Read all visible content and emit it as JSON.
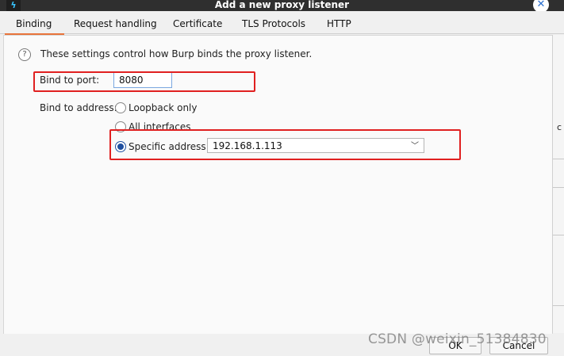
{
  "window": {
    "title": "Add a new proxy listener",
    "app_icon_glyph": "ϟ",
    "close_glyph": "✕"
  },
  "tabs": [
    {
      "label": "Binding",
      "active": true
    },
    {
      "label": "Request handling",
      "active": false
    },
    {
      "label": "Certificate",
      "active": false
    },
    {
      "label": "TLS Protocols",
      "active": false
    },
    {
      "label": "HTTP",
      "active": false
    }
  ],
  "binding": {
    "help_glyph": "?",
    "description": "These settings control how Burp binds the proxy listener.",
    "port_label": "Bind to port:",
    "port_value": "8080",
    "address_label": "Bind to address:",
    "options": [
      {
        "label": "Loopback only",
        "selected": false
      },
      {
        "label": "All interfaces",
        "selected": false
      },
      {
        "label": "Specific address:",
        "selected": true
      }
    ],
    "specific_address_value": "192.168.1.113",
    "dropdown_chevron": "﹀"
  },
  "side_panel": {
    "partial_text": "c"
  },
  "footer": {
    "ok_label": "OK",
    "cancel_label": "Cancel"
  },
  "watermark": "CSDN @weixin_51384830",
  "colors": {
    "highlight_box": "#e02020",
    "active_tab_underline": "#e8743b",
    "radio_selected": "#1f4fa0"
  }
}
